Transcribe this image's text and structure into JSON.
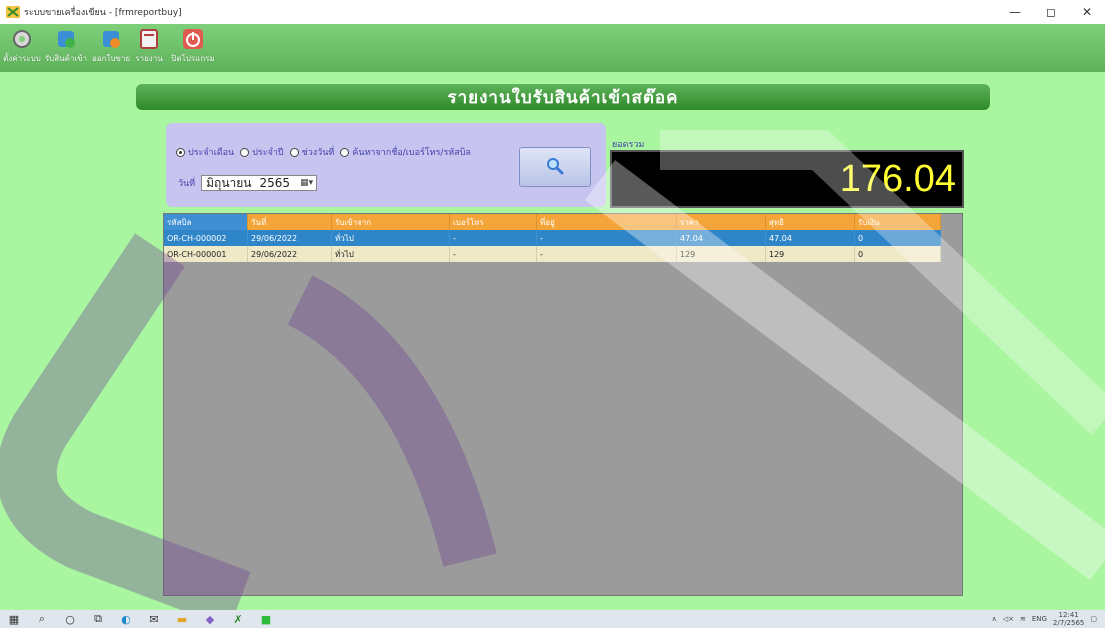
{
  "window": {
    "title": "ระบบขายเครื่องเขียน - [frmreportbuy]",
    "minimize": "—",
    "maximize": "◻",
    "close": "✕"
  },
  "toolbar": {
    "items": [
      {
        "label": "ตั้งค่าระบบ",
        "icon": "gear-icon"
      },
      {
        "label": "รับสินค้าเข้า",
        "icon": "receive-goods-icon"
      },
      {
        "label": "ออกใบขาย",
        "icon": "sales-bill-icon"
      },
      {
        "label": "รายงาน",
        "icon": "report-icon"
      },
      {
        "label": "ปิดโปรแกรม",
        "icon": "power-icon"
      }
    ]
  },
  "header": {
    "title": "รายงานใบรับสินค้าเข้าสต๊อค"
  },
  "filter": {
    "options": [
      {
        "label": "ประจำเดือน",
        "selected": true
      },
      {
        "label": "ประจำปี",
        "selected": false
      },
      {
        "label": "ช่วงวันที่",
        "selected": false
      },
      {
        "label": "ค้นหาจากชื่อ/เบอร์โทร/รหัสบิล",
        "selected": false
      }
    ],
    "date_label": "วันที่",
    "month": "มิถุนายน",
    "year": "2565"
  },
  "total": {
    "label": "ยอดรวม",
    "value": "176.04"
  },
  "grid": {
    "columns": [
      "รหัสบิล",
      "วันที่",
      "รับเข้าจาก",
      "เบอร์โทร",
      "ที่อยู่",
      "ราคา",
      "สุทธิ",
      "รับเงิน"
    ],
    "rows": [
      [
        "OR-CH-000002",
        "29/06/2022",
        "ทั่วไป",
        "-",
        "-",
        "47.04",
        "47.04",
        "0"
      ],
      [
        "OR-CH-000001",
        "29/06/2022",
        "ทั่วไป",
        "-",
        "-",
        "129",
        "129",
        "0"
      ]
    ]
  },
  "taskbar": {
    "lang": "ENG",
    "time": "12:41",
    "date": "2/7/2565"
  },
  "colors": {
    "background": "#a9f5a0",
    "header": "#2e8a2a",
    "total_text": "#ffff33",
    "grid_header": "#f4a53a",
    "selected_row": "#2e85c8"
  }
}
